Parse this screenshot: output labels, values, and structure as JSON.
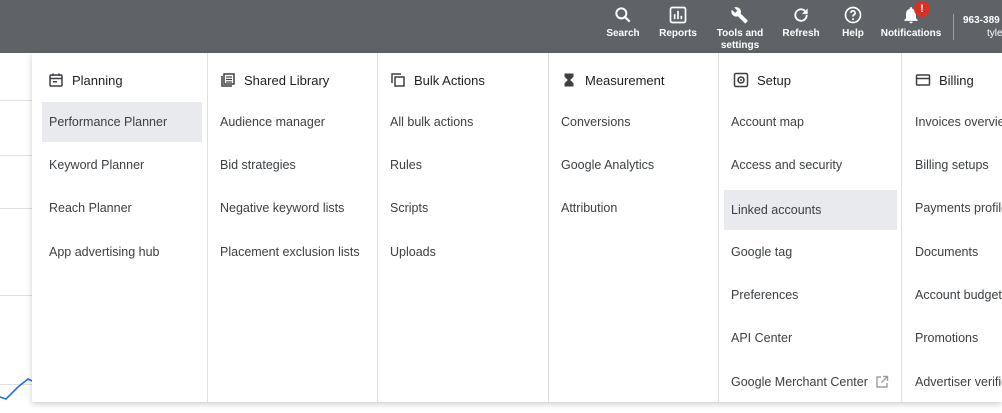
{
  "topbar": {
    "items": [
      {
        "label": "Search",
        "icon": "search-icon"
      },
      {
        "label": "Reports",
        "icon": "reports-icon"
      },
      {
        "label": "Tools and settings",
        "line1": "Tools and",
        "line2": "settings",
        "icon": "wrench-icon"
      },
      {
        "label": "Refresh",
        "icon": "refresh-icon"
      },
      {
        "label": "Help",
        "icon": "help-icon"
      },
      {
        "label": "Notifications",
        "icon": "bell-icon",
        "badge": "!"
      }
    ],
    "account_id": "963-389",
    "account_name": "tyle"
  },
  "menu": {
    "columns": [
      {
        "title": "Planning",
        "icon": "calendar-icon",
        "items": [
          "Performance Planner",
          "Keyword Planner",
          "Reach Planner",
          "App advertising hub"
        ],
        "selected": 0
      },
      {
        "title": "Shared Library",
        "icon": "library-icon",
        "items": [
          "Audience manager",
          "Bid strategies",
          "Negative keyword lists",
          "Placement exclusion lists"
        ]
      },
      {
        "title": "Bulk Actions",
        "icon": "copy-icon",
        "items": [
          "All bulk actions",
          "Rules",
          "Scripts",
          "Uploads"
        ]
      },
      {
        "title": "Measurement",
        "icon": "hourglass-icon",
        "items": [
          "Conversions",
          "Google Analytics",
          "Attribution"
        ]
      },
      {
        "title": "Setup",
        "icon": "gear-box-icon",
        "items": [
          "Account map",
          "Access and security",
          "Linked accounts",
          "Google tag",
          "Preferences",
          "API Center",
          "Google Merchant Center"
        ],
        "selected": 2,
        "external_item": 6
      },
      {
        "title": "Billing",
        "icon": "card-icon",
        "items": [
          "Invoices overview",
          "Billing setups",
          "Payments profile",
          "Documents",
          "Account budgets",
          "Promotions",
          "Advertiser verification"
        ]
      }
    ]
  },
  "colors": {
    "topbar": "#5f6368",
    "selected": "#e8eaed",
    "badge": "#d93025",
    "chart_line": "#1a73e8"
  }
}
